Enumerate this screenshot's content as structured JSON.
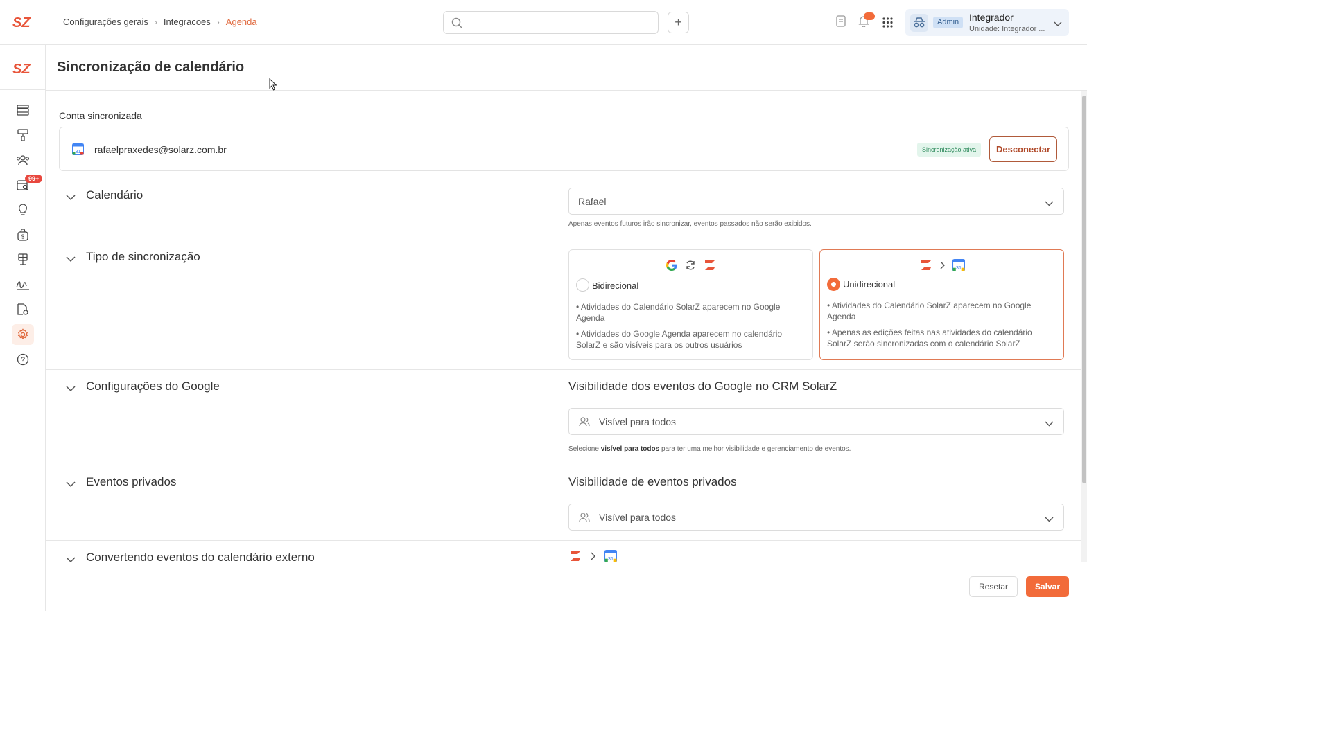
{
  "app": {
    "brand": "SZ",
    "accent": "#f26b3a"
  },
  "breadcrumb": {
    "items": [
      "Configurações gerais",
      "Integracoes",
      "Agenda"
    ]
  },
  "search": {
    "placeholder": ""
  },
  "topbar": {
    "add_label": "+"
  },
  "user": {
    "role_badge": "Admin",
    "name": "Integrador",
    "unit": "Unidade: Integrador ..."
  },
  "sidebar": {
    "badge": "99+",
    "items": [
      "list-icon",
      "paint-roller-icon",
      "users-icon",
      "calendar-search-icon",
      "lightbulb-icon",
      "money-bag-icon",
      "solar-panel-icon",
      "signature-icon",
      "document-settings-icon",
      "gear-icon",
      "help-icon"
    ],
    "active": "gear-icon"
  },
  "page": {
    "title": "Sincronização de calendário"
  },
  "account": {
    "label": "Conta sincronizada",
    "email": "rafaelpraxedes@solarz.com.br",
    "status": "Sincronização ativa",
    "disconnect": "Desconectar"
  },
  "sections": {
    "calendar": {
      "title": "Calendário",
      "selected": "Rafael",
      "hint": "Apenas eventos futuros irão sincronizar, eventos passados não serão exibidos."
    },
    "sync_type": {
      "title": "Tipo de sincronização",
      "options": [
        {
          "label": "Bidirecional",
          "selected": false,
          "bullets": [
            "• Atividades do Calendário SolarZ aparecem no Google Agenda",
            "• Atividades do Google Agenda aparecem no calendário SolarZ e são visíveis para os outros usuários"
          ]
        },
        {
          "label": "Unidirecional",
          "selected": true,
          "bullets": [
            "• Atividades do Calendário SolarZ aparecem no Google Agenda",
            "• Apenas as edições feitas nas atividades do calendário SolarZ serão sincronizadas com o calendário SolarZ"
          ]
        }
      ]
    },
    "google": {
      "title": "Configurações do Google",
      "right_title": "Visibilidade dos eventos do Google no CRM SolarZ",
      "selected": "Visível para todos",
      "hint_pre": "Selecione ",
      "hint_bold": "visível para todos",
      "hint_post": " para ter uma melhor visibilidade e gerenciamento de eventos."
    },
    "private": {
      "title": "Eventos privados",
      "right_title": "Visibilidade de eventos privados",
      "selected": "Visível para todos"
    },
    "convert": {
      "title": "Convertendo eventos do calendário externo"
    }
  },
  "footer": {
    "reset": "Resetar",
    "save": "Salvar"
  }
}
